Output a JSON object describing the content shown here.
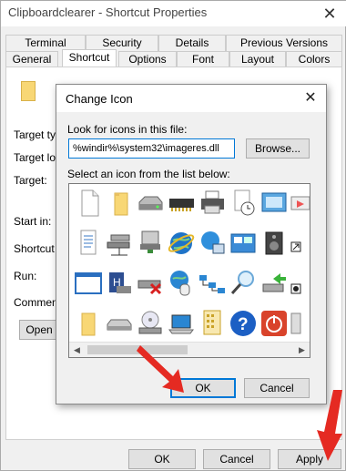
{
  "window": {
    "title": "Clipboardclearer - Shortcut Properties",
    "close_glyph": "✕"
  },
  "tabs": {
    "top_row": [
      "Terminal",
      "Security",
      "Details",
      "Previous Versions"
    ],
    "bottom_row": [
      "General",
      "Shortcut",
      "Options",
      "Font",
      "Layout",
      "Colors"
    ],
    "active": "Shortcut"
  },
  "shortcut_fields": {
    "target_type": "Target typ",
    "target_location": "Target loc",
    "target": "Target:",
    "start_in": "Start in:",
    "shortcut_key": "Shortcut k",
    "run": "Run:",
    "comment": "Comment:",
    "open_button": "Open"
  },
  "bottom_buttons": {
    "ok": "OK",
    "cancel": "Cancel",
    "apply": "Apply"
  },
  "dialog": {
    "title": "Change Icon",
    "close_glyph": "✕",
    "look_label": "Look for icons in this file:",
    "path_value": "%windir%\\system32\\imageres.dll",
    "browse": "Browse...",
    "select_label": "Select an icon from the list below:",
    "ok": "OK",
    "cancel": "Cancel",
    "scroll_left": "◀",
    "scroll_right": "▶",
    "icons": [
      "blank-document-icon",
      "folder-icon",
      "hard-drive-icon",
      "memory-chip-icon",
      "printer-icon",
      "document-clock-icon",
      "monitor-window-icon",
      "text-document-icon",
      "network-drives-icon",
      "network-server-icon",
      "internet-globe-icon",
      "network-globe-icon",
      "control-panel-icon",
      "speaker-icon",
      "application-window-icon",
      "floppy-save-icon",
      "drive-error-icon",
      "globe-mouse-icon",
      "network-topology-icon",
      "search-magnifier-icon",
      "green-arrow-drive-icon",
      "folder-small-icon",
      "removable-drive-icon",
      "cd-drive-icon",
      "laptop-icon",
      "document-grid-icon",
      "help-question-icon",
      "power-button-icon"
    ]
  },
  "colors": {
    "accent": "#0078d7",
    "arrow": "#e52a22",
    "help_blue": "#1c5fc4",
    "power_red": "#d9432b",
    "folder_yellow": "#f8d775"
  }
}
